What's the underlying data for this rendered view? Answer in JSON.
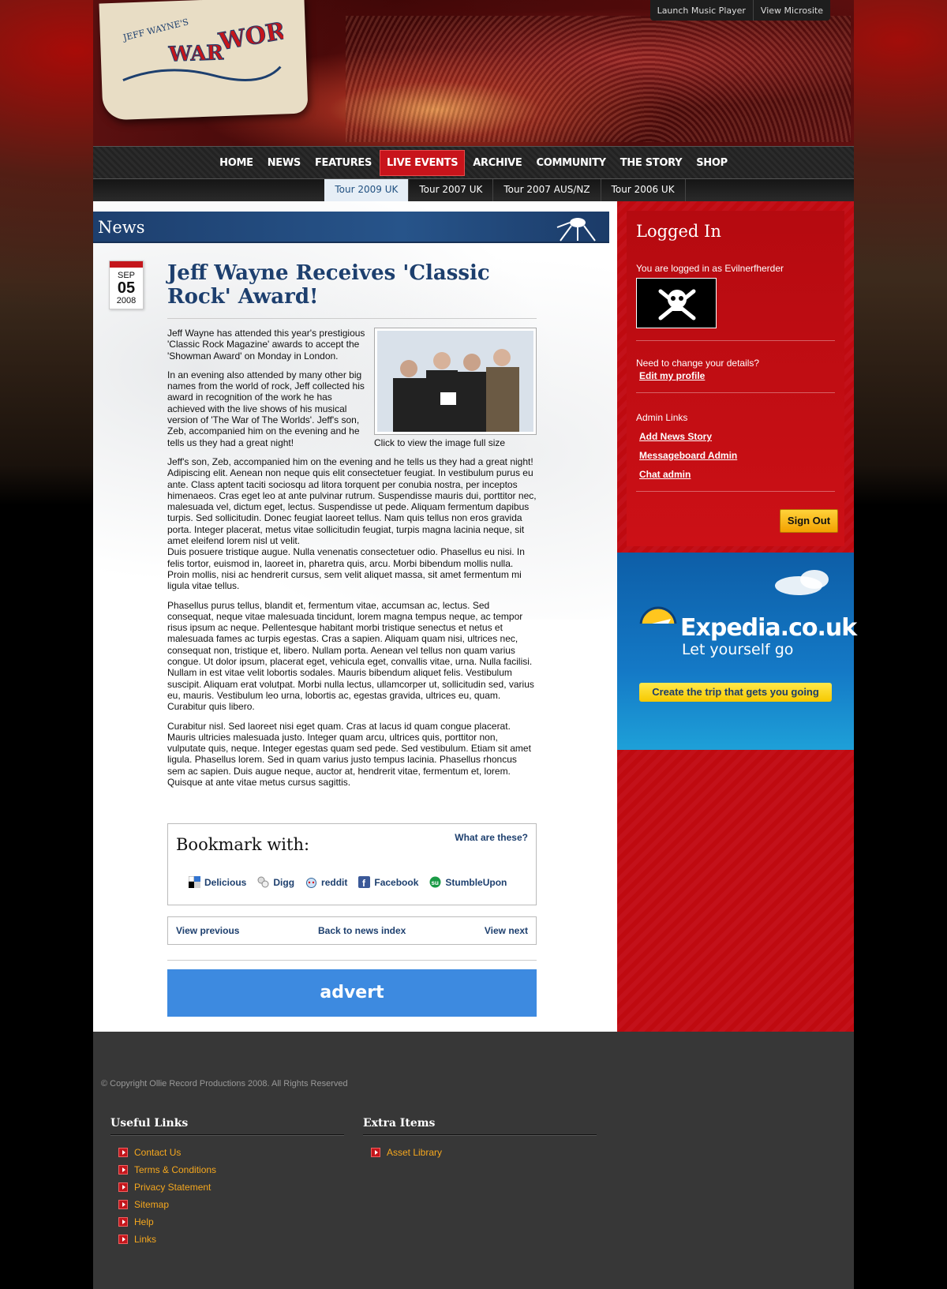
{
  "header": {
    "logo_text": "Jeff Wayne's Musical Version of The War of the Worlds",
    "top_links": [
      "Launch Music Player",
      "View Microsite"
    ]
  },
  "nav": {
    "items": [
      "HOME",
      "NEWS",
      "FEATURES",
      "LIVE EVENTS",
      "ARCHIVE",
      "COMMUNITY",
      "THE STORY",
      "SHOP"
    ],
    "active": "LIVE EVENTS",
    "sub_items": [
      "Tour 2009 UK",
      "Tour 2007 UK",
      "Tour 2007 AUS/NZ",
      "Tour 2006 UK"
    ],
    "sub_active": "Tour 2009 UK"
  },
  "news": {
    "banner": "News",
    "date": {
      "month": "SEP",
      "day": "05",
      "year": "2008"
    },
    "title": "Jeff Wayne Receives 'Classic Rock' Award!",
    "image_caption": "Click to view the image full size",
    "paragraphs": [
      "Jeff Wayne has attended this year's prestigious 'Classic Rock Magazine' awards to accept the 'Showman Award' on Monday in London.",
      "In an evening also attended by many other big names from the world of rock, Jeff collected his award in recognition of the work he has achieved with the live shows of his musical version of 'The War of The Worlds'. Jeff's son, Zeb, accompanied him on the evening and he tells us they had a great night!",
      "Jeff's son, Zeb, accompanied him on the evening and he tells us they had a great night! Adipiscing elit. Aenean non neque quis elit consectetuer feugiat. In vestibulum purus eu ante. Class aptent taciti sociosqu ad litora torquent per conubia nostra, per inceptos himenaeos. Cras eget leo at ante pulvinar rutrum. Suspendisse mauris dui, porttitor nec, malesuada vel, dictum eget, lectus. Suspendisse ut pede. Aliquam fermentum dapibus turpis. Sed sollicitudin. Donec feugiat laoreet tellus. Nam quis tellus non eros gravida porta. Integer placerat, metus vitae sollicitudin feugiat, turpis magna lacinia neque, sit amet eleifend lorem nisl ut velit.",
      "Duis posuere tristique augue. Nulla venenatis consectetuer odio. Phasellus eu nisi. In felis tortor, euismod in, laoreet in, pharetra quis, arcu. Morbi bibendum mollis nulla. Proin mollis, nisi ac hendrerit cursus, sem velit aliquet massa, sit amet fermentum mi ligula vitae tellus.",
      "Phasellus purus tellus, blandit et, fermentum vitae, accumsan ac, lectus. Sed consequat, neque vitae malesuada tincidunt, lorem magna tempus neque, ac tempor risus ipsum ac neque. Pellentesque habitant morbi tristique senectus et netus et malesuada fames ac turpis egestas. Cras a sapien. Aliquam quam nisi, ultrices nec, consequat non, tristique et, libero. Nullam porta. Aenean vel tellus non quam varius congue. Ut dolor ipsum, placerat eget, vehicula eget, convallis vitae, urna. Nulla facilisi. Nullam in est vitae velit lobortis sodales. Mauris bibendum aliquet felis. Vestibulum suscipit. Aliquam erat volutpat. Morbi nulla lectus, ullamcorper ut, sollicitudin sed, varius eu, mauris. Vestibulum leo urna, lobortis ac, egestas gravida, ultrices eu, quam. Curabitur quis libero.",
      "Curabitur nisl. Sed laoreet nisi eget quam. Cras at lacus id quam congue placerat. Mauris ultricies malesuada justo. Integer quam arcu, ultrices quis, porttitor non, vulputate quis, neque. Integer egestas quam sed pede. Sed vestibulum. Etiam sit amet ligula. Phasellus lorem. Sed in quam varius justo tempus lacinia. Phasellus rhoncus sem ac sapien. Duis augue neque, auctor at, hendrerit vitae, fermentum et, lorem. Quisque at ante vitae metus cursus sagittis."
    ],
    "bookmark": {
      "heading": "Bookmark with:",
      "what": "What are these?",
      "services": [
        "Delicious",
        "Digg",
        "reddit",
        "Facebook",
        "StumbleUpon"
      ]
    },
    "pager": {
      "prev": "View previous",
      "index": "Back to news index",
      "next": "View next"
    },
    "advert": "advert"
  },
  "sidebar": {
    "heading": "Logged In",
    "logged_in_text": "You are logged in as Evilnerfherder",
    "change_details": "Need to change your details?",
    "edit_profile": "Edit my profile",
    "admin_heading": "Admin Links",
    "admin_links": [
      "Add News Story",
      "Messageboard Admin",
      "Chat admin"
    ],
    "sign_out": "Sign Out",
    "ad": {
      "brand": "Expedia.co.uk",
      "tagline": "Let yourself go",
      "cta": "Create the trip that gets you going"
    }
  },
  "footer": {
    "copyright": "© Copyright Ollie Record Productions 2008. All Rights Reserved",
    "useful_links_title": "Useful Links",
    "useful_links": [
      "Contact Us",
      "Terms & Conditions",
      "Privacy Statement",
      "Sitemap",
      "Help",
      "Links"
    ],
    "extra_title": "Extra Items",
    "extra_links": [
      "Asset Library"
    ]
  },
  "colors": {
    "accent_red": "#c4161c",
    "link_blue": "#1d3f6e",
    "footer_link": "#f5a71e"
  }
}
